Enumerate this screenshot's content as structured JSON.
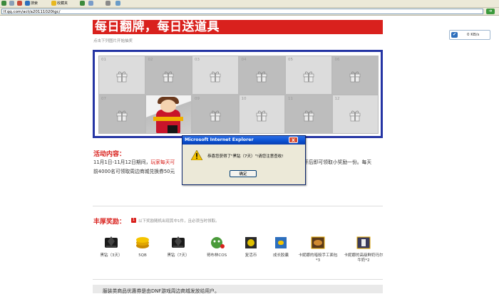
{
  "browser": {
    "toolbar": {
      "search_label": "搜索",
      "favorites_label": "收藏夹"
    },
    "address": {
      "url": "lf.qq.com/act/a20111020tgc/"
    }
  },
  "banner": {
    "title": "每日翻牌，每日送道具",
    "subtitle": "点击下列图片开始抽奖"
  },
  "speed_widget": {
    "text": "0 KB/s"
  },
  "cards": [
    {
      "num": "01",
      "state": "gift"
    },
    {
      "num": "02",
      "state": "gift"
    },
    {
      "num": "03",
      "state": "gift"
    },
    {
      "num": "04",
      "state": "gift"
    },
    {
      "num": "05",
      "state": "gift"
    },
    {
      "num": "06",
      "state": "gift"
    },
    {
      "num": "07",
      "state": "gift"
    },
    {
      "num": "",
      "state": "revealed"
    },
    {
      "num": "09",
      "state": "gift"
    },
    {
      "num": "10",
      "state": "gift"
    },
    {
      "num": "11",
      "state": "gift"
    },
    {
      "num": "12",
      "state": "gift"
    }
  ],
  "activity": {
    "title": "活动内容：",
    "line1_prefix": "11月1日-11月12日期间，",
    "line1_highlight": "玩家每天可",
    "line2": "前4000名可领取周边商城兑换券50元",
    "line1_right": "开后即可领取小奖励一份。每天",
    "line2_right": ""
  },
  "rewards": {
    "title": "丰厚奖励：",
    "badge": "1",
    "note": "以下奖励随机出现其中1件，且必须当时领取。",
    "items": [
      {
        "label": "黑钻（3天）",
        "icon": "black-diamond-icon"
      },
      {
        "label": "5QB",
        "icon": "coin-icon"
      },
      {
        "label": "黑钻（7天）",
        "icon": "black-diamond-icon"
      },
      {
        "label": "哥布林COS",
        "icon": "goblin-icon"
      },
      {
        "label": "复活币",
        "icon": "revive-coin-icon"
      },
      {
        "label": "成长胶囊",
        "icon": "capsule-icon"
      },
      {
        "label": "卡妮娜的暗殺手工面包*3",
        "icon": "bread-icon"
      },
      {
        "label": "卡妮娜的高级鲜奶玛尔牛奶*2",
        "icon": "milk-icon"
      }
    ]
  },
  "footer": {
    "text": "服装类商品优惠券是由DNF游戏周边商城发放给用户。"
  },
  "dialog": {
    "title": "Microsoft Internet Explorer",
    "close": "X",
    "message": "恭喜您获得了\"黑钻（7天）\"!请您注意查收!",
    "ok_label": "确定"
  },
  "colors": {
    "accent_red": "#d9211d",
    "board_border": "#2535a4",
    "dialog_title": "#0a50d0"
  }
}
